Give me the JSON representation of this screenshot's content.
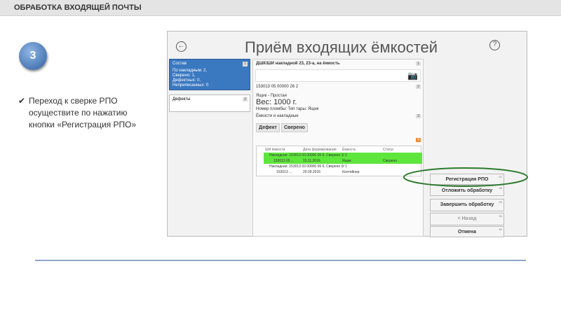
{
  "header": {
    "title": "ОБРАБОТКА ВХОДЯЩЕЙ ПОЧТЫ"
  },
  "step": {
    "number": "3"
  },
  "instruction": {
    "check": "✔",
    "text": "Переход к сверке РПО осуществите по нажатию кнопки «Регистрация РПО»"
  },
  "app": {
    "title": "Приём входящих ёмкостей",
    "back_icon": "←",
    "help_icon": "?",
    "composition": {
      "title": "Состав",
      "badge": "1",
      "lines": [
        "По накладным: 2,",
        "Сверено: 1,",
        "Дефектных: 0,",
        "Неприписанных: 0"
      ]
    },
    "defects": {
      "title": "Дефекты",
      "badge": "2"
    },
    "scan_label": "ДШК/ШИ накладной 23, 23-а, на ёмкость",
    "scan_badge": "1",
    "barcode": "153013 05 00000 26 2",
    "barcode_badge": "2",
    "box_type": "Ящик - Простая",
    "weight": "Вес: 1000 г.",
    "seal": "Номер пломбы: Тип тары: Ящик",
    "containers_label": "Ёмкости и накладные",
    "containers_badge": "3",
    "defect_btn": "Дефект",
    "verified_btn": "Сверено",
    "grid_badge": "4",
    "columns": [
      "ШИ ёмкости",
      "Дата формирования",
      "Ёмкость",
      "Статус"
    ],
    "rows": [
      {
        "c": [
          "Накладная: 153013 03 00000 05 9, Сверено 1/ 2"
        ]
      },
      {
        "c": [
          "153013 05 ...",
          "15.11.2016",
          "Ящик",
          "Сверено"
        ]
      },
      {
        "c": [
          "Накладная: 153013 03 00000 06 6, Сверено 0/ 1"
        ]
      },
      {
        "c": [
          "153013 ...",
          "20.09.2016",
          "Контейнер",
          ""
        ]
      }
    ],
    "buttons": [
      {
        "label": "Регистрация РПО",
        "key": "07"
      },
      {
        "label": "Отложить обработку",
        "key": "08"
      },
      {
        "label": "Завершить обработку",
        "key": "02"
      },
      {
        "label": "< Назад",
        "key": "01"
      },
      {
        "label": "Отмена",
        "key": "00"
      }
    ],
    "highlight_color": "#5ee63c"
  }
}
